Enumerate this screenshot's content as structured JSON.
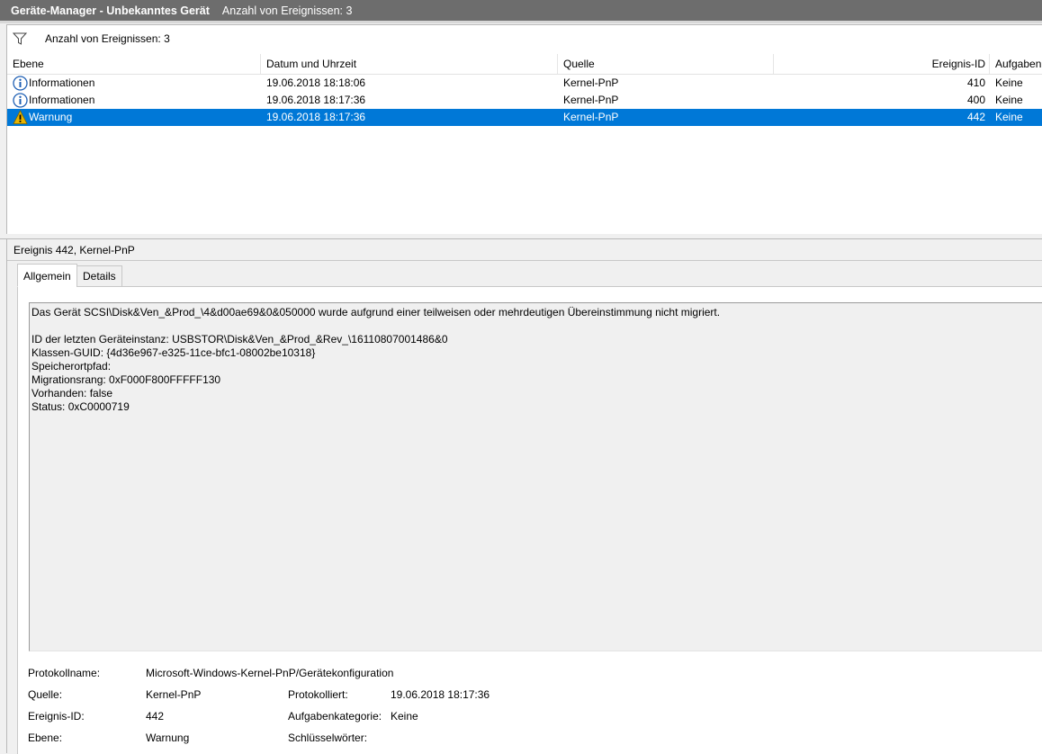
{
  "window": {
    "title": "Geräte-Manager - Unbekanntes Gerät",
    "subtitle": "Anzahl von Ereignissen: 3"
  },
  "filter": {
    "icon": "filter-icon",
    "text": "Anzahl von Ereignissen: 3"
  },
  "columns": [
    "Ebene",
    "Datum und Uhrzeit",
    "Quelle",
    "Ereignis-ID",
    "Aufgaben"
  ],
  "events": [
    {
      "icon": "info-icon",
      "level": "Informationen",
      "datetime": "19.06.2018 18:18:06",
      "source": "Kernel-PnP",
      "id": "410",
      "task": "Keine"
    },
    {
      "icon": "info-icon",
      "level": "Informationen",
      "datetime": "19.06.2018 18:17:36",
      "source": "Kernel-PnP",
      "id": "400",
      "task": "Keine"
    },
    {
      "icon": "warning-icon",
      "level": "Warnung",
      "datetime": "19.06.2018 18:17:36",
      "source": "Kernel-PnP",
      "id": "442",
      "task": "Keine"
    }
  ],
  "detail": {
    "title": "Ereignis 442, Kernel-PnP",
    "tabs": [
      "Allgemein",
      "Details"
    ],
    "description": [
      "Das Gerät SCSI\\Disk&Ven_&Prod_\\4&d00ae69&0&050000 wurde aufgrund einer teilweisen oder mehrdeutigen Übereinstimmung nicht migriert.",
      "",
      "ID der letzten Geräteinstanz: USBSTOR\\Disk&Ven_&Prod_&Rev_\\16110807001486&0",
      "Klassen-GUID: {4d36e967-e325-11ce-bfc1-08002be10318}",
      "Speicherortpfad:",
      "Migrationsrang: 0xF000F800FFFFF130",
      "Vorhanden: false",
      "Status: 0xC0000719"
    ],
    "props": {
      "protokollname_label": "Protokollname:",
      "protokollname_value": "Microsoft-Windows-Kernel-PnP/Gerätekonfiguration",
      "quelle_label": "Quelle:",
      "quelle_value": "Kernel-PnP",
      "protokolliert_label": "Protokolliert:",
      "protokolliert_value": "19.06.2018 18:17:36",
      "id_label": "Ereignis-ID:",
      "id_value": "442",
      "kategorie_label": "Aufgabenkategorie:",
      "kategorie_value": "Keine",
      "ebene_label": "Ebene:",
      "ebene_value": "Warnung",
      "schluessel_label": "Schlüsselwörter:",
      "schluessel_value": ""
    }
  },
  "colors": {
    "selection": "#0078d7",
    "titlebar": "#6d6d6d",
    "info": "#1e5fb4",
    "warning": "#e8b400"
  }
}
